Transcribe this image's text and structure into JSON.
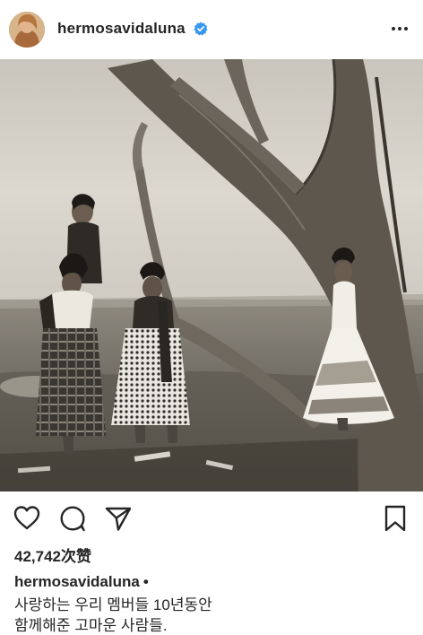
{
  "post": {
    "username": "hermosavidaluna",
    "verified_icon": "verified-badge-icon",
    "more_icon": "more-options-icon",
    "likes": "42,742次赞",
    "caption": {
      "username": "hermosavidaluna",
      "dot": "•",
      "line1": "사랑하는 우리 멤버들 10년동안",
      "line2": "함께해준 고마운 사람들."
    },
    "actions": [
      "like-icon",
      "comment-icon",
      "share-icon",
      "save-icon"
    ],
    "colors": {
      "text": "#262626",
      "verified": "#3897f0",
      "background": "#ffffff"
    }
  }
}
